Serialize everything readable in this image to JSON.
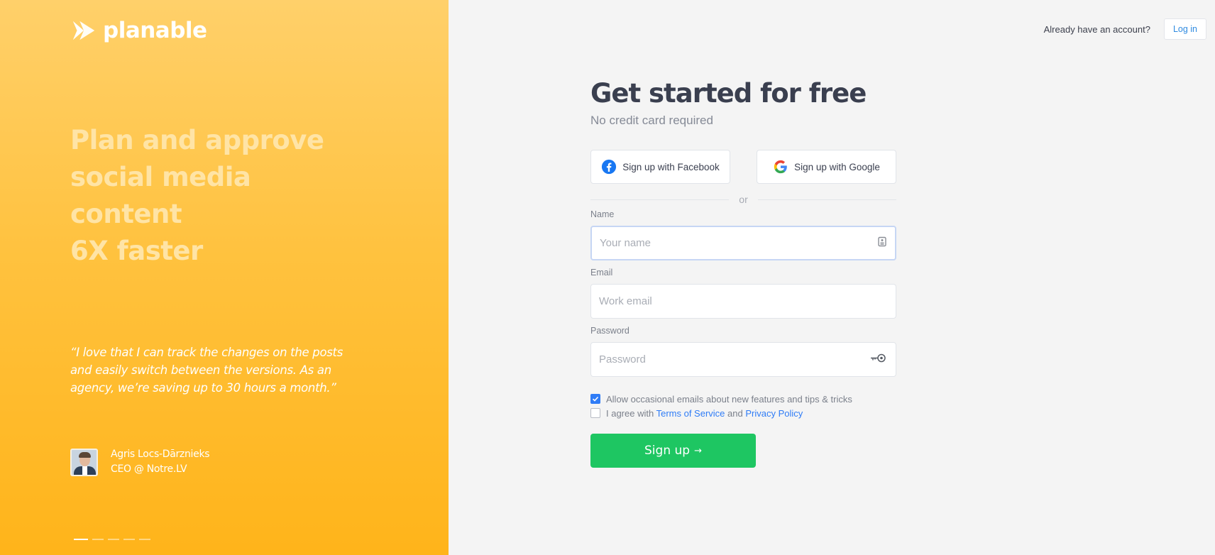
{
  "brand": {
    "name": "planable"
  },
  "hero": {
    "headline_lines": [
      "Plan and approve",
      "social media content",
      "6X faster"
    ],
    "quote": "“I love that I can track the changes on the posts and easily switch between the versions. As an agency, we’re saving up to 30 hours a month.”",
    "author_name": "Agris Locs-Dārznieks",
    "author_role": "CEO @ Notre.LV"
  },
  "header": {
    "already_text": "Already have an account?",
    "login_label": "Log in"
  },
  "form": {
    "title": "Get started for free",
    "subtitle": "No credit card required",
    "facebook_label": "Sign up with Facebook",
    "google_label": "Sign up with Google",
    "or_text": "or",
    "name_label": "Name",
    "name_placeholder": "Your name",
    "email_label": "Email",
    "email_placeholder": "Work email",
    "password_label": "Password",
    "password_placeholder": "Password",
    "emails_opt_in": "Allow occasional emails about new features and tips & tricks",
    "emails_opt_in_checked": true,
    "agree_prefix": "I agree with",
    "terms_label": "Terms of Service",
    "agree_and": "and",
    "privacy_label": "Privacy Policy",
    "agree_checked": false,
    "signup_label": "Sign up",
    "signup_arrow": "→"
  },
  "colors": {
    "accent_green": "#1ec662",
    "link_blue": "#2f7cf6",
    "panel_yellow": "#ffb41a"
  }
}
